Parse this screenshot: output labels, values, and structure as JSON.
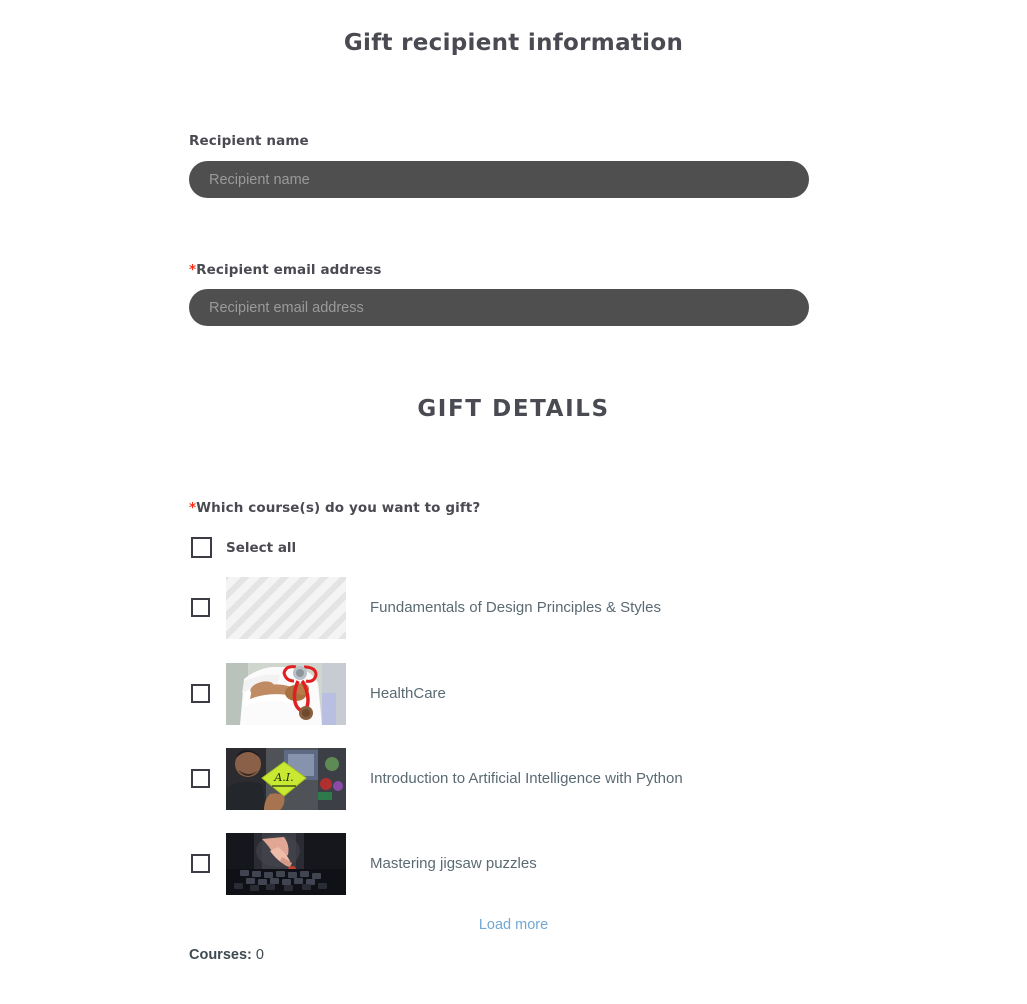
{
  "headings": {
    "main": "Gift recipient information",
    "gift_details": "GIFT DETAILS"
  },
  "form": {
    "recipient_name": {
      "label": "Recipient name",
      "placeholder": "Recipient name",
      "value": "",
      "required": false
    },
    "recipient_email": {
      "label": "Recipient email address",
      "placeholder": "Recipient email address",
      "value": "",
      "required": true,
      "required_marker": "*"
    }
  },
  "course_question": {
    "required_marker": "*",
    "label": "Which course(s) do you want to gift?",
    "select_all_label": "Select all",
    "select_all_checked": false
  },
  "courses": [
    {
      "title": "Fundamentals of Design Principles & Styles",
      "checked": false,
      "thumbnail": "striped-placeholder-image"
    },
    {
      "title": "HealthCare",
      "checked": false,
      "thumbnail": "doctor-stethoscope-image"
    },
    {
      "title": "Introduction to Artificial Intelligence with Python",
      "checked": false,
      "thumbnail": "ai-sticky-note-image"
    },
    {
      "title": "Mastering jigsaw puzzles",
      "checked": false,
      "thumbnail": "jigsaw-puzzle-hands-image"
    }
  ],
  "load_more": {
    "label": "Load more"
  },
  "counter": {
    "label": "Courses:",
    "value": "0"
  },
  "colors": {
    "heading": "#4a4a52",
    "input_background": "#4f4f4f",
    "input_placeholder": "#9a9a9a",
    "required_star": "#ff2d16",
    "link": "#71a8d4",
    "course_title": "#5a6a73"
  }
}
